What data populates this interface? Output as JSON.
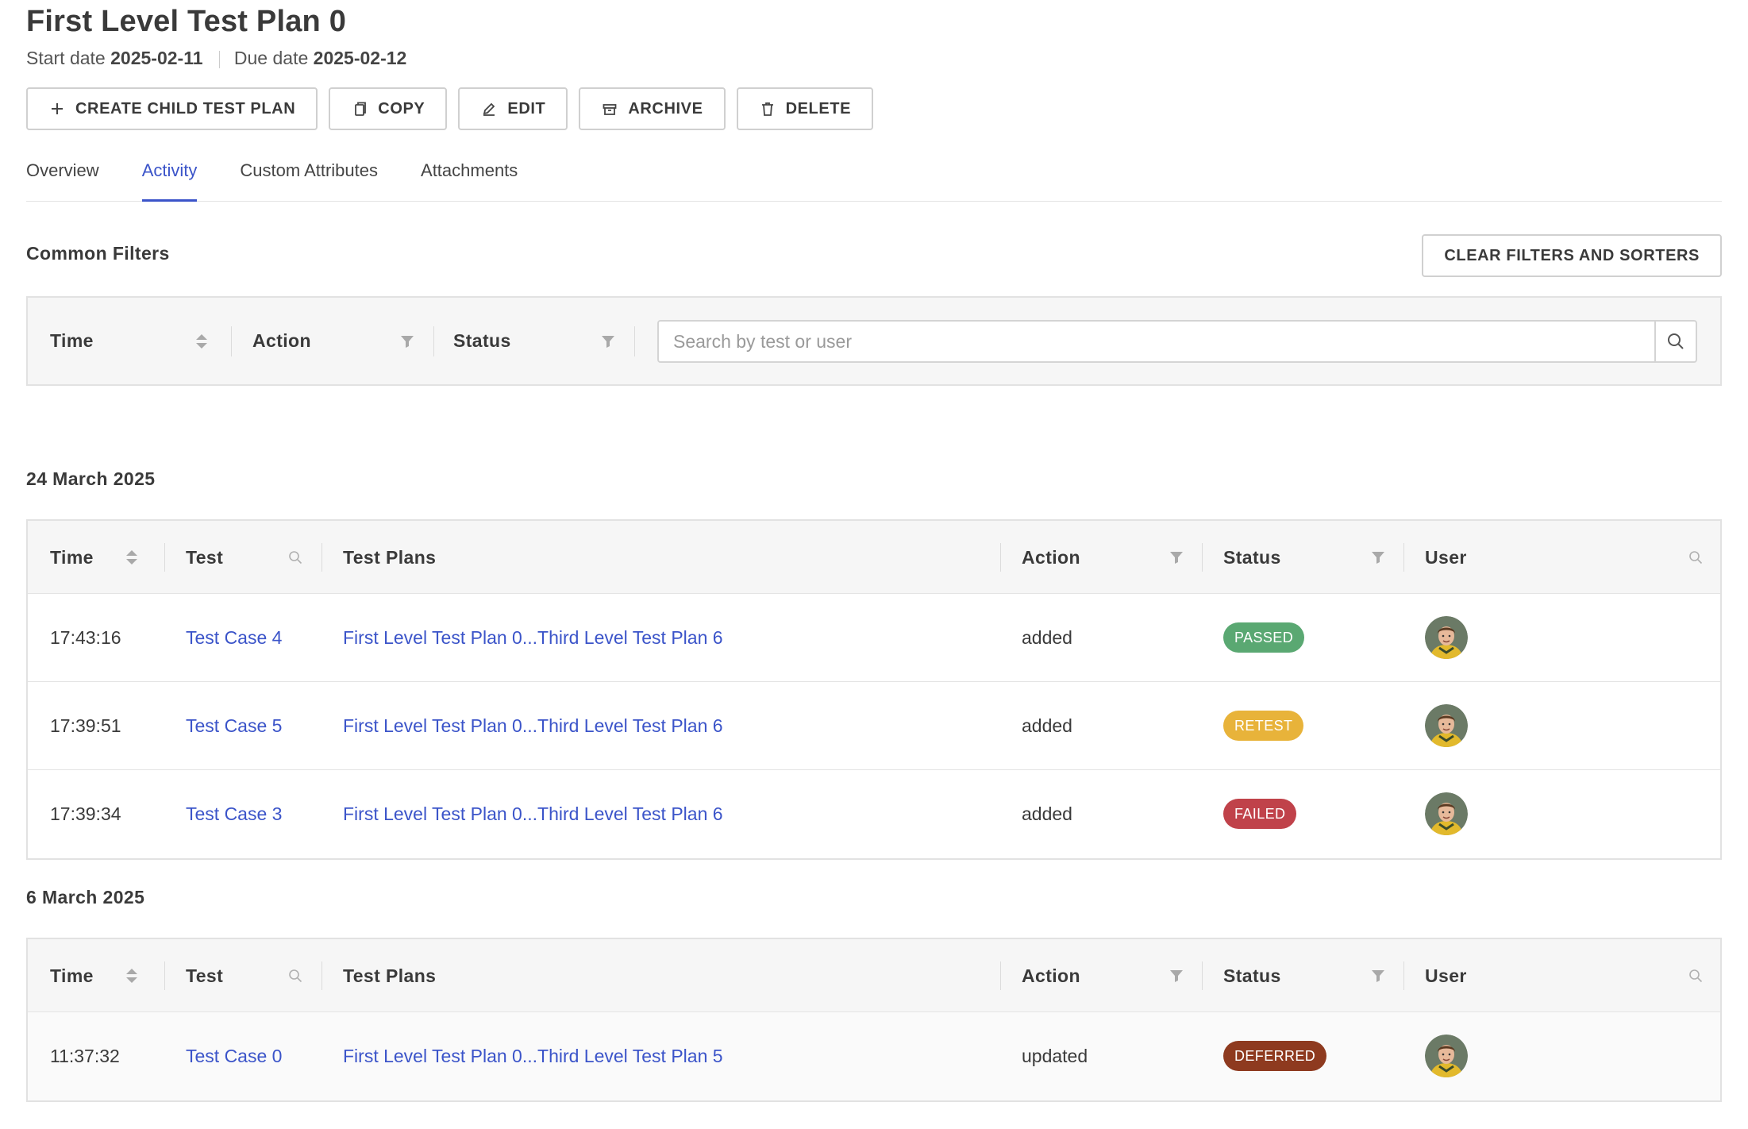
{
  "header": {
    "title": "First Level Test Plan 0",
    "start_label": "Start date",
    "start_value": "2025-02-11",
    "due_label": "Due date",
    "due_value": "2025-02-12"
  },
  "actions": {
    "create_child": "CREATE CHILD TEST PLAN",
    "copy": "COPY",
    "edit": "EDIT",
    "archive": "ARCHIVE",
    "delete": "DELETE"
  },
  "tabs": {
    "overview": "Overview",
    "activity": "Activity",
    "custom_attributes": "Custom Attributes",
    "attachments": "Attachments",
    "active": "Activity"
  },
  "common_filters": {
    "title": "Common Filters",
    "clear_button": "CLEAR FILTERS AND SORTERS",
    "time": "Time",
    "action": "Action",
    "status": "Status",
    "search_placeholder": "Search by test or user"
  },
  "columns": {
    "time": "Time",
    "test": "Test",
    "test_plans": "Test Plans",
    "action": "Action",
    "status": "Status",
    "user": "User"
  },
  "status_colors": {
    "PASSED": "#5aa872",
    "RETEST": "#e8b33a",
    "FAILED": "#c0424a",
    "DEFERRED": "#8e3a1f"
  },
  "accent_color": "#3b54c9",
  "groups": [
    {
      "date": "24 March 2025",
      "rows": [
        {
          "time": "17:43:16",
          "test": "Test Case 4",
          "test_plans": "First Level Test Plan 0...Third Level Test Plan 6",
          "action": "added",
          "status": "PASSED"
        },
        {
          "time": "17:39:51",
          "test": "Test Case 5",
          "test_plans": "First Level Test Plan 0...Third Level Test Plan 6",
          "action": "added",
          "status": "RETEST"
        },
        {
          "time": "17:39:34",
          "test": "Test Case 3",
          "test_plans": "First Level Test Plan 0...Third Level Test Plan 6",
          "action": "added",
          "status": "FAILED"
        }
      ]
    },
    {
      "date": "6 March 2025",
      "rows": [
        {
          "time": "11:37:32",
          "test": "Test Case 0",
          "test_plans": "First Level Test Plan 0...Third Level Test Plan 5",
          "action": "updated",
          "status": "DEFERRED"
        }
      ]
    }
  ]
}
